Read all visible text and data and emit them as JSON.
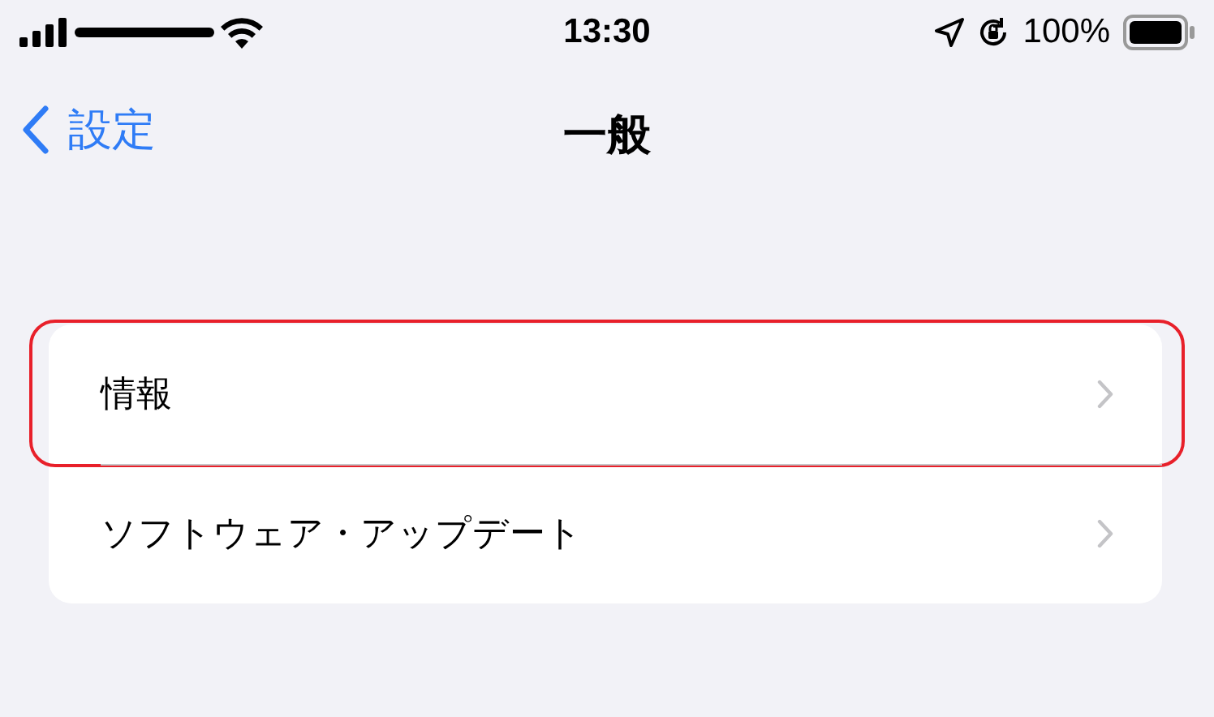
{
  "status_bar": {
    "carrier_redacted": true,
    "time": "13:30",
    "battery": "100%"
  },
  "nav": {
    "back": "設定",
    "title": "一般"
  },
  "items": [
    {
      "label": "情報",
      "highlighted": true
    },
    {
      "label": "ソフトウェア・アップデート",
      "highlighted": false
    }
  ]
}
